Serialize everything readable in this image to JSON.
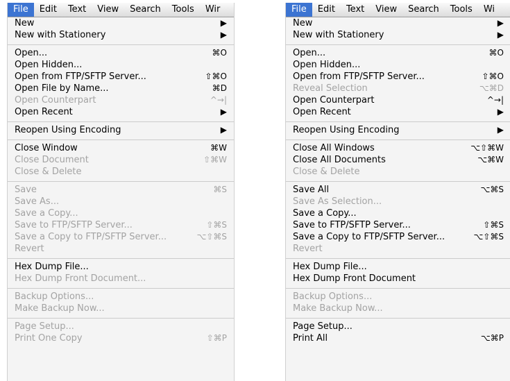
{
  "left": {
    "menubar": [
      "File",
      "Edit",
      "Text",
      "View",
      "Search",
      "Tools",
      "Wir"
    ],
    "menu": [
      {
        "label": "New",
        "shortcut": "▶",
        "enabled": true
      },
      {
        "label": "New with Stationery",
        "shortcut": "▶",
        "enabled": true
      },
      {
        "sep": true
      },
      {
        "label": "Open...",
        "shortcut": "⌘O",
        "enabled": true
      },
      {
        "label": "Open Hidden...",
        "shortcut": "",
        "enabled": true
      },
      {
        "label": "Open from FTP/SFTP Server...",
        "shortcut": "⇧⌘O",
        "enabled": true
      },
      {
        "label": "Open File by Name...",
        "shortcut": "⌘D",
        "enabled": true
      },
      {
        "label": "Open Counterpart",
        "shortcut": "^→|",
        "enabled": false
      },
      {
        "label": "Open Recent",
        "shortcut": "▶",
        "enabled": true
      },
      {
        "sep": true
      },
      {
        "label": "Reopen Using Encoding",
        "shortcut": "▶",
        "enabled": true
      },
      {
        "sep": true
      },
      {
        "label": "Close Window",
        "shortcut": "⌘W",
        "enabled": true
      },
      {
        "label": "Close Document",
        "shortcut": "⇧⌘W",
        "enabled": false
      },
      {
        "label": "Close & Delete",
        "shortcut": "",
        "enabled": false
      },
      {
        "sep": true
      },
      {
        "label": "Save",
        "shortcut": "⌘S",
        "enabled": false
      },
      {
        "label": "Save As...",
        "shortcut": "",
        "enabled": false
      },
      {
        "label": "Save a Copy...",
        "shortcut": "",
        "enabled": false
      },
      {
        "label": "Save to FTP/SFTP Server...",
        "shortcut": "⇧⌘S",
        "enabled": false
      },
      {
        "label": "Save a Copy to FTP/SFTP Server...",
        "shortcut": "⌥⇧⌘S",
        "enabled": false
      },
      {
        "label": "Revert",
        "shortcut": "",
        "enabled": false
      },
      {
        "sep": true
      },
      {
        "label": "Hex Dump File...",
        "shortcut": "",
        "enabled": true
      },
      {
        "label": "Hex Dump Front Document...",
        "shortcut": "",
        "enabled": false
      },
      {
        "sep": true
      },
      {
        "label": "Backup Options...",
        "shortcut": "",
        "enabled": false
      },
      {
        "label": "Make Backup Now...",
        "shortcut": "",
        "enabled": false
      },
      {
        "sep": true
      },
      {
        "label": "Page Setup...",
        "shortcut": "",
        "enabled": false
      },
      {
        "label": "Print One Copy",
        "shortcut": "⇧⌘P",
        "enabled": false
      }
    ]
  },
  "right": {
    "menubar": [
      "File",
      "Edit",
      "Text",
      "View",
      "Search",
      "Tools",
      "Wi"
    ],
    "menu": [
      {
        "label": "New",
        "shortcut": "▶",
        "enabled": true
      },
      {
        "label": "New with Stationery",
        "shortcut": "▶",
        "enabled": true
      },
      {
        "sep": true
      },
      {
        "label": "Open...",
        "shortcut": "⌘O",
        "enabled": true
      },
      {
        "label": "Open Hidden...",
        "shortcut": "",
        "enabled": true
      },
      {
        "label": "Open from FTP/SFTP Server...",
        "shortcut": "⇧⌘O",
        "enabled": true
      },
      {
        "label": "Reveal Selection",
        "shortcut": "⌥⌘D",
        "enabled": false
      },
      {
        "label": "Open Counterpart",
        "shortcut": "^→|",
        "enabled": true
      },
      {
        "label": "Open Recent",
        "shortcut": "▶",
        "enabled": true
      },
      {
        "sep": true
      },
      {
        "label": "Reopen Using Encoding",
        "shortcut": "▶",
        "enabled": true
      },
      {
        "sep": true
      },
      {
        "label": "Close All Windows",
        "shortcut": "⌥⇧⌘W",
        "enabled": true
      },
      {
        "label": "Close All Documents",
        "shortcut": "⌥⌘W",
        "enabled": true
      },
      {
        "label": "Close & Delete",
        "shortcut": "",
        "enabled": false
      },
      {
        "sep": true
      },
      {
        "label": "Save All",
        "shortcut": "⌥⌘S",
        "enabled": true
      },
      {
        "label": "Save As Selection...",
        "shortcut": "",
        "enabled": false
      },
      {
        "label": "Save a Copy...",
        "shortcut": "",
        "enabled": true
      },
      {
        "label": "Save to FTP/SFTP Server...",
        "shortcut": "⇧⌘S",
        "enabled": true
      },
      {
        "label": "Save a Copy to FTP/SFTP Server...",
        "shortcut": "⌥⇧⌘S",
        "enabled": true
      },
      {
        "label": "Revert",
        "shortcut": "",
        "enabled": false
      },
      {
        "sep": true
      },
      {
        "label": "Hex Dump File...",
        "shortcut": "",
        "enabled": true
      },
      {
        "label": "Hex Dump Front Document",
        "shortcut": "",
        "enabled": true
      },
      {
        "sep": true
      },
      {
        "label": "Backup Options...",
        "shortcut": "",
        "enabled": false
      },
      {
        "label": "Make Backup Now...",
        "shortcut": "",
        "enabled": false
      },
      {
        "sep": true
      },
      {
        "label": "Page Setup...",
        "shortcut": "",
        "enabled": true
      },
      {
        "label": "Print All",
        "shortcut": "⌥⌘P",
        "enabled": true
      }
    ]
  },
  "colors": {
    "menu_bg": "#f4f4f4",
    "active_title": "#3c74d2",
    "disabled_text": "#a3a3a3"
  }
}
